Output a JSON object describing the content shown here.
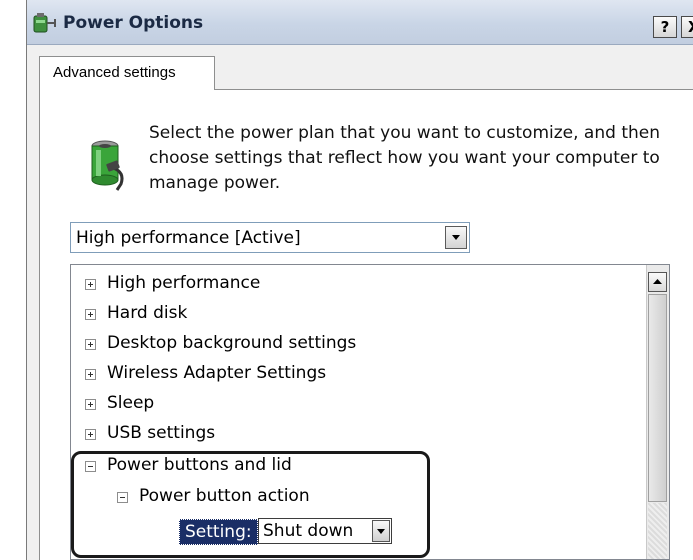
{
  "window": {
    "title": "Power Options",
    "help_label": "?",
    "close_label": "X"
  },
  "tabs": [
    {
      "label": "Advanced settings",
      "selected": true
    }
  ],
  "description": "Select the power plan that you want to customize, and then choose settings that reflect how you want your computer to manage power.",
  "plan_selector": {
    "value": "High performance [Active]"
  },
  "settings_tree": {
    "items": [
      {
        "label": "High performance",
        "expanded": false
      },
      {
        "label": "Hard disk",
        "expanded": false
      },
      {
        "label": "Desktop background settings",
        "expanded": false
      },
      {
        "label": "Wireless Adapter Settings",
        "expanded": false
      },
      {
        "label": "Sleep",
        "expanded": false
      },
      {
        "label": "USB settings",
        "expanded": false
      },
      {
        "label": "Power buttons and lid",
        "expanded": true
      },
      {
        "label": "Power button action",
        "expanded": true
      }
    ],
    "setting": {
      "label": "Setting:",
      "value": "Shut down"
    }
  },
  "icons": {
    "app": "power-options-icon",
    "plan": "battery-plug-icon"
  },
  "colors": {
    "title_bar": "#c9d5e6",
    "selection": "#1a2e66",
    "battery_green": "#3aa53a"
  }
}
